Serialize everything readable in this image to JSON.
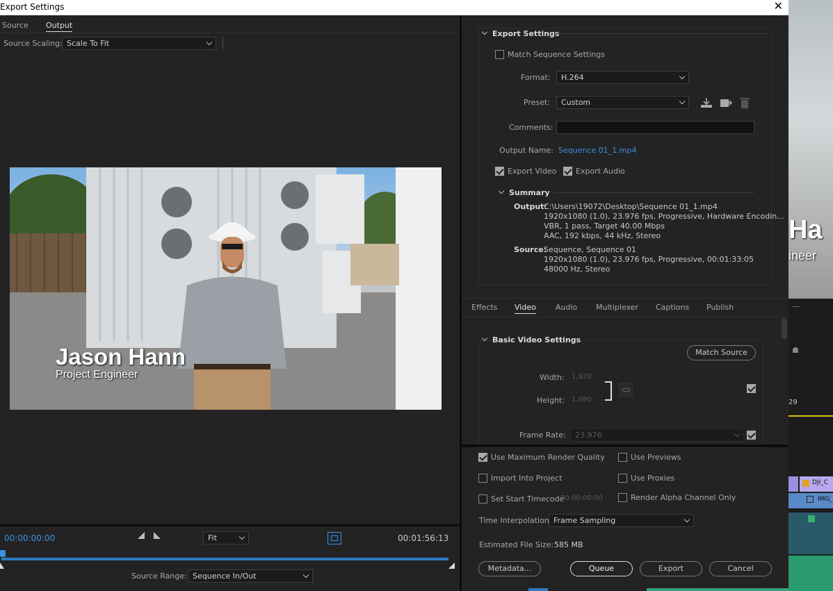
{
  "window": {
    "title": "Export Settings",
    "close_glyph": "✕"
  },
  "left_tabs": [
    "Source",
    "Output"
  ],
  "source_scaling": {
    "label": "Source Scaling:",
    "value": "Scale To Fit"
  },
  "preview": {
    "name": "Jason Hann",
    "role": "Project Engineer"
  },
  "timeline": {
    "current_time": "00:00:00:00",
    "fit": "Fit",
    "duration": "00:01:56:13",
    "source_range_label": "Source Range:",
    "source_range_value": "Sequence In/Out"
  },
  "export_settings": {
    "heading": "Export Settings",
    "match_sequence": "Match Sequence Settings",
    "format_label": "Format:",
    "format_value": "H.264",
    "preset_label": "Preset:",
    "preset_value": "Custom",
    "comments_label": "Comments:",
    "output_name_label": "Output Name:",
    "output_name_value": "Sequence 01_1.mp4",
    "export_video": "Export Video",
    "export_audio": "Export Audio",
    "summary_heading": "Summary",
    "output_label": "Output:",
    "output_lines": [
      "C:\\Users\\19072\\Desktop\\Sequence 01_1.mp4",
      "1920x1080 (1.0), 23.976 fps, Progressive, Hardware Encodin...",
      "VBR, 1 pass, Target 40.00 Mbps",
      "AAC, 192 kbps, 44 kHz, Stereo"
    ],
    "source_label": "Source:",
    "source_lines": [
      "Sequence, Sequence 01",
      "1920x1080 (1.0), 23.976 fps, Progressive, 00:01:33:05",
      "48000 Hz, Stereo"
    ]
  },
  "settings_tabs": [
    "Effects",
    "Video",
    "Audio",
    "Multiplexer",
    "Captions",
    "Publish"
  ],
  "basic_video": {
    "heading": "Basic Video Settings",
    "match_source": "Match Source",
    "width_label": "Width:",
    "width_value": "1,920",
    "height_label": "Height:",
    "height_value": "1,080",
    "frame_rate_label": "Frame Rate:",
    "frame_rate_value": "23.976"
  },
  "render": {
    "max_render_quality": "Use Maximum Render Quality",
    "use_previews": "Use Previews",
    "import_into_project": "Import Into Project",
    "use_proxies": "Use Proxies",
    "set_start_timecode": "Set Start Timecode",
    "start_timecode_value": "00:00:00:00",
    "render_alpha": "Render Alpha Channel Only",
    "time_interp_label": "Time Interpolation:",
    "time_interp_value": "Frame Sampling",
    "file_size_label": "Estimated File Size:",
    "file_size_value": "585 MB"
  },
  "buttons": {
    "metadata": "Metadata...",
    "queue": "Queue",
    "export": "Export",
    "cancel": "Cancel"
  },
  "background": {
    "text_ha": "Ha",
    "text_ineer": "ineer",
    "frame_29": "29",
    "clip1": "DJI_C",
    "clip2": "IMG_"
  }
}
